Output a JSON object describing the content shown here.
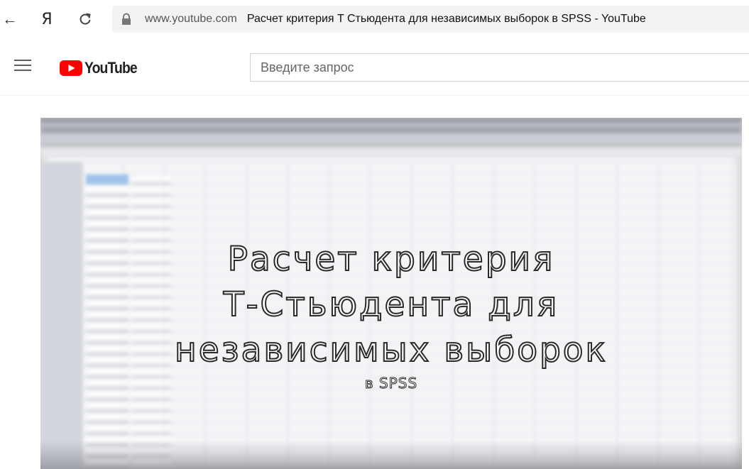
{
  "browser": {
    "back_icon": "←",
    "yandex_icon": "Я",
    "address": {
      "domain": "www.youtube.com",
      "page_title": "Расчет критерия T Стьюдента для независимых выборок в SPSS - YouTube"
    }
  },
  "youtube": {
    "logo_text": "YouTube",
    "brand_color": "#ff0000",
    "search": {
      "placeholder": "Введите запрос",
      "value": ""
    }
  },
  "video": {
    "title_lines": [
      "Расчет критерия",
      "Т-Стьюдента для",
      "независимых выборок"
    ],
    "subtitle": "в SPSS"
  }
}
